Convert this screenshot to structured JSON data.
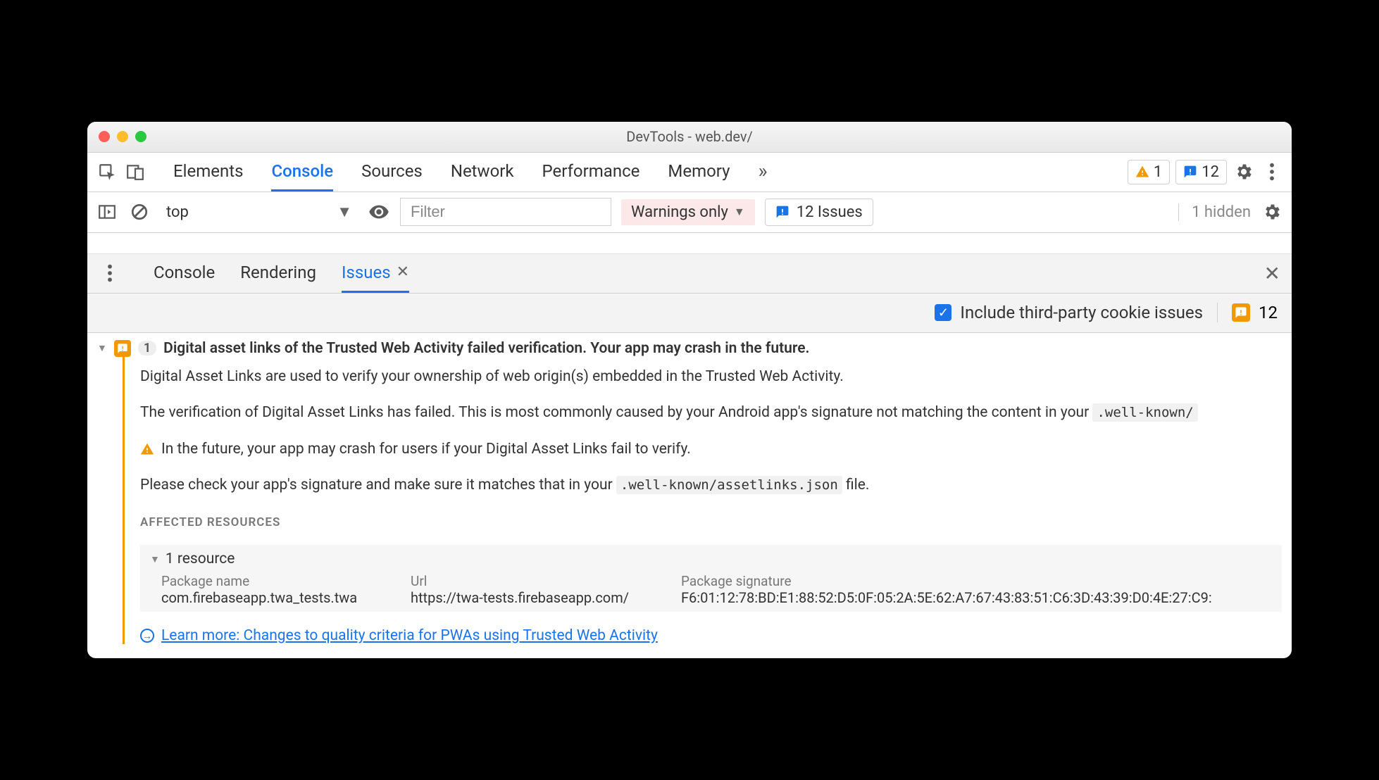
{
  "window": {
    "title": "DevTools - web.dev/"
  },
  "mainTabs": [
    "Elements",
    "Console",
    "Sources",
    "Network",
    "Performance",
    "Memory"
  ],
  "mainTabActive": "Console",
  "badges": {
    "warnings": "1",
    "issues": "12"
  },
  "consoleBar": {
    "context": "top",
    "filterPlaceholder": "Filter",
    "level": "Warnings only",
    "issuesButton": "12 Issues",
    "hidden": "1 hidden"
  },
  "drawerTabs": [
    "Console",
    "Rendering",
    "Issues"
  ],
  "drawerActive": "Issues",
  "issuesToolbar": {
    "checkboxLabel": "Include third-party cookie issues",
    "count": "12"
  },
  "issue": {
    "count": "1",
    "title": "Digital asset links of the Trusted Web Activity failed verification. Your app may crash in the future.",
    "p1": "Digital Asset Links are used to verify your ownership of web origin(s) embedded in the Trusted Web Activity.",
    "p2a": "The verification of Digital Asset Links has failed. This is most commonly caused by your Android app's signature not matching the content in your ",
    "p2code": ".well-known/",
    "p3": "In the future, your app may crash for users if your Digital Asset Links fail to verify.",
    "p4a": "Please check your app's signature and make sure it matches that in your ",
    "p4code": ".well-known/assetlinks.json",
    "p4b": " file.",
    "affectedLabel": "AFFECTED RESOURCES",
    "resourceCount": "1 resource",
    "table": {
      "headers": [
        "Package name",
        "Url",
        "Package signature"
      ],
      "row": [
        "com.firebaseapp.twa_tests.twa",
        "https://twa-tests.firebaseapp.com/",
        "F6:01:12:78:BD:E1:88:52:D5:0F:05:2A:5E:62:A7:67:43:83:51:C6:3D:43:39:D0:4E:27:C9:"
      ]
    },
    "learnMore": "Learn more: Changes to quality criteria for PWAs using Trusted Web Activity"
  }
}
